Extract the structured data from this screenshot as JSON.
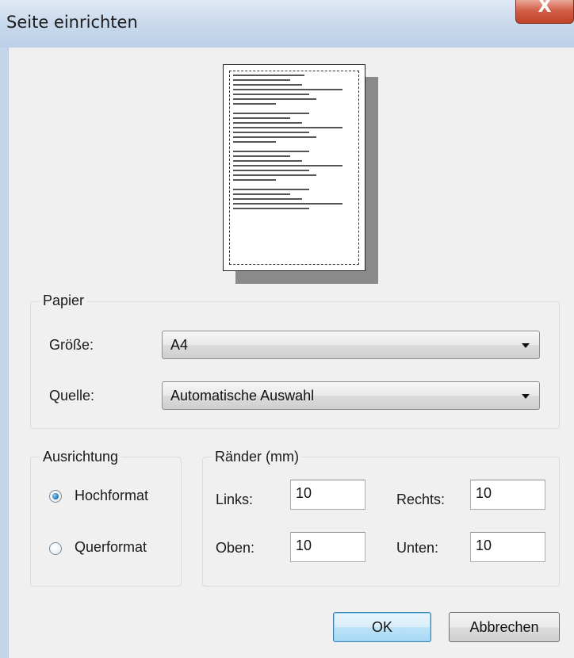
{
  "window": {
    "title": "Seite einrichten",
    "close_glyph": "X"
  },
  "papier": {
    "legend": "Papier",
    "size_label": "Größe:",
    "size_value": "A4",
    "source_label": "Quelle:",
    "source_value": "Automatische Auswahl"
  },
  "orientation": {
    "legend": "Ausrichtung",
    "portrait_label": "Hochformat",
    "landscape_label": "Querformat",
    "selected": "Hochformat"
  },
  "margins": {
    "legend": "Ränder (mm)",
    "left_label": "Links:",
    "left_value": "10",
    "right_label": "Rechts:",
    "right_value": "10",
    "top_label": "Oben:",
    "top_value": "10",
    "bottom_label": "Unten:",
    "bottom_value": "10"
  },
  "buttons": {
    "ok": "OK",
    "cancel": "Abbrechen"
  }
}
